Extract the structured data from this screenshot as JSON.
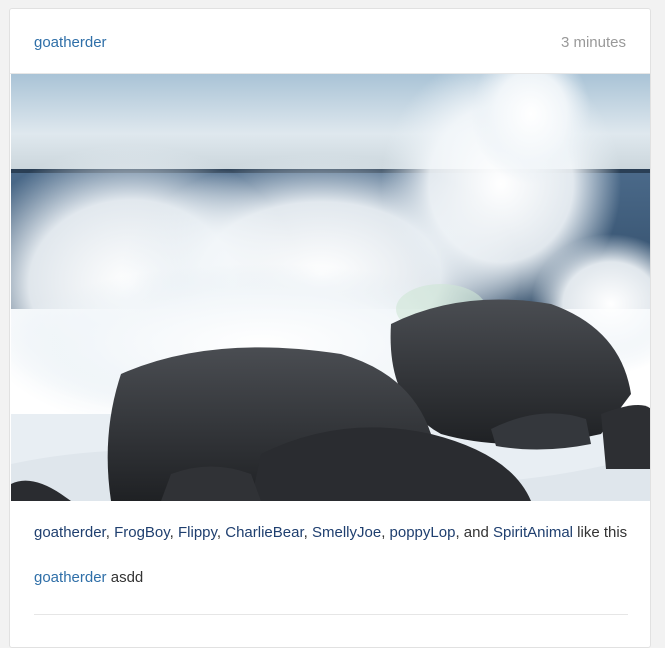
{
  "post": {
    "author": "goatherder",
    "time_ago": "3 minutes",
    "photo": {
      "alt": ""
    },
    "likes": {
      "users": [
        "goatherder",
        "FrogBoy",
        "Flippy",
        "CharlieBear",
        "SmellyJoe",
        "poppyLop",
        "SpiritAnimal"
      ],
      "sep_comma": ", ",
      "sep_and": ", and ",
      "suffix": " like this"
    },
    "comment": {
      "author": "goatherder",
      "text": " asdd"
    }
  }
}
